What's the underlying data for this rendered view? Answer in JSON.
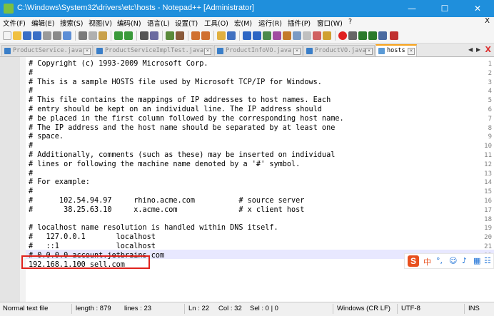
{
  "window": {
    "title": "C:\\Windows\\System32\\drivers\\etc\\hosts - Notepad++ [Administrator]",
    "minimize": "—",
    "maximize": "☐",
    "close": "✕"
  },
  "menu": {
    "items": [
      "文件(F)",
      "编辑(E)",
      "搜索(S)",
      "视图(V)",
      "编码(N)",
      "语言(L)",
      "设置(T)",
      "工具(O)",
      "宏(M)",
      "运行(R)",
      "插件(P)",
      "窗口(W)",
      "?"
    ],
    "close": "X"
  },
  "tabs": [
    {
      "label": "ProductService.java",
      "active": false
    },
    {
      "label": "ProductServiceImplTest.java",
      "active": false
    },
    {
      "label": "ProductInfoVO.java",
      "active": false
    },
    {
      "label": "ProductVO.java",
      "active": false
    },
    {
      "label": "hosts",
      "active": true
    }
  ],
  "tab_controls": {
    "left": "◀",
    "right": "▶",
    "close": "X"
  },
  "editor": {
    "lines": [
      {
        "n": "1",
        "text": "# Copyright (c) 1993-2009 Microsoft Corp."
      },
      {
        "n": "2",
        "text": "#"
      },
      {
        "n": "3",
        "text": "# This is a sample HOSTS file used by Microsoft TCP/IP for Windows."
      },
      {
        "n": "4",
        "text": "#"
      },
      {
        "n": "5",
        "text": "# This file contains the mappings of IP addresses to host names. Each"
      },
      {
        "n": "6",
        "text": "# entry should be kept on an individual line. The IP address should"
      },
      {
        "n": "7",
        "text": "# be placed in the first column followed by the corresponding host name."
      },
      {
        "n": "8",
        "text": "# The IP address and the host name should be separated by at least one"
      },
      {
        "n": "9",
        "text": "# space."
      },
      {
        "n": "10",
        "text": "#"
      },
      {
        "n": "11",
        "text": "# Additionally, comments (such as these) may be inserted on individual"
      },
      {
        "n": "12",
        "text": "# lines or following the machine name denoted by a '#' symbol."
      },
      {
        "n": "13",
        "text": "#"
      },
      {
        "n": "14",
        "text": "# For example:"
      },
      {
        "n": "15",
        "text": "#"
      },
      {
        "n": "16",
        "text": "#      102.54.94.97     rhino.acme.com          # source server"
      },
      {
        "n": "17",
        "text": "#       38.25.63.10     x.acme.com              # x client host"
      },
      {
        "n": "18",
        "text": ""
      },
      {
        "n": "19",
        "text": "# localhost name resolution is handled within DNS itself."
      },
      {
        "n": "20",
        "text": "#   127.0.0.1       localhost"
      },
      {
        "n": "21",
        "text": "#   ::1             localhost"
      },
      {
        "n": "22",
        "text": "# 0.0.0.0 account.jetbrains.com"
      },
      {
        "n": "23",
        "text": "192.168.1.100 sell.com"
      }
    ]
  },
  "ime": {
    "cn": "中",
    "punct": "°,",
    "emoji": "☺",
    "mic": "♪",
    "keyboard": "▦",
    "skin": "☷",
    "logo": "S"
  },
  "status": {
    "filetype": "Normal text file",
    "length": "length : 879",
    "lines": "lines : 23",
    "ln": "Ln : 22",
    "col": "Col : 32",
    "sel": "Sel : 0 | 0",
    "eol": "Windows (CR LF)",
    "encoding": "UTF-8",
    "mode": "INS"
  }
}
